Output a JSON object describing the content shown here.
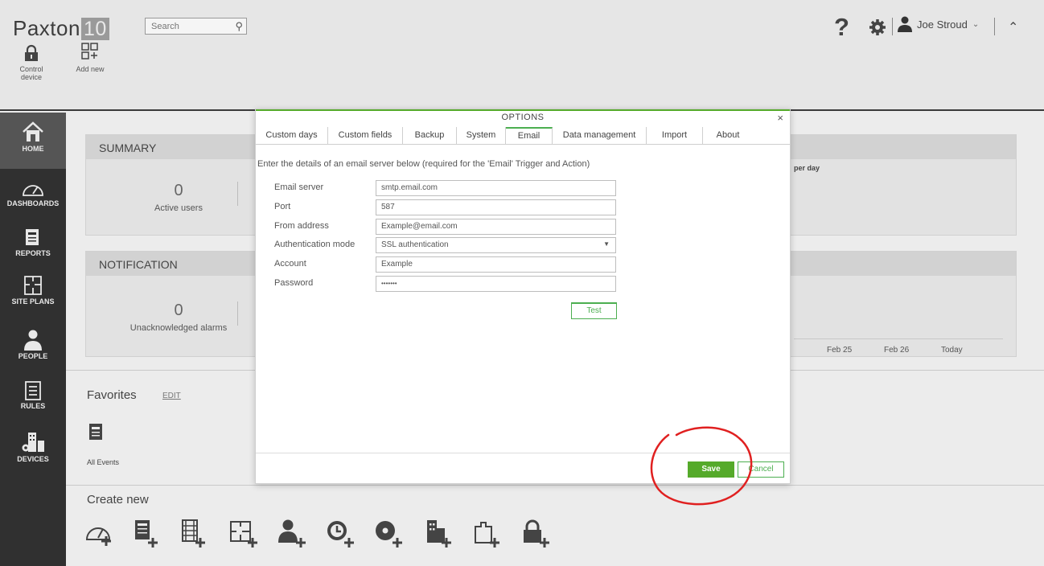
{
  "app": {
    "name": "Paxton",
    "version": "10"
  },
  "search": {
    "placeholder": "Search"
  },
  "toolbar": {
    "control_device": "Control device",
    "add_new": "Add new"
  },
  "user": {
    "name": "Joe Stroud"
  },
  "sidebar": {
    "items": [
      {
        "label": "HOME",
        "icon": "home-icon",
        "active": true
      },
      {
        "label": "DASHBOARDS",
        "icon": "gauge-icon"
      },
      {
        "label": "REPORTS",
        "icon": "report-icon"
      },
      {
        "label": "SITE PLANS",
        "icon": "site-plan-icon"
      },
      {
        "label": "PEOPLE",
        "icon": "person-icon"
      },
      {
        "label": "RULES",
        "icon": "rules-icon"
      },
      {
        "label": "DEVICES",
        "icon": "devices-icon"
      }
    ]
  },
  "summary": {
    "title": "SUMMARY",
    "value": "0",
    "label": "Active users"
  },
  "notification": {
    "title": "NOTIFICATION",
    "value": "0",
    "label": "Unacknowledged alarms"
  },
  "chart": {
    "title": "per day",
    "x_labels": [
      "Feb 25",
      "Feb 26",
      "Today"
    ]
  },
  "favorites": {
    "title": "Favorites",
    "edit": "EDIT",
    "items": [
      {
        "label": "All Events",
        "icon": "report-icon"
      }
    ]
  },
  "create_new": {
    "title": "Create new",
    "items": [
      "dashboard-add-icon",
      "report-add-icon",
      "video-report-add-icon",
      "site-plan-add-icon",
      "person-add-icon",
      "time-profile-add-icon",
      "software-add-icon",
      "building-add-icon",
      "system-rule-add-icon",
      "device-add-icon"
    ]
  },
  "dialog": {
    "title": "OPTIONS",
    "close": "×",
    "tabs": [
      "Custom days",
      "Custom fields",
      "Backup",
      "System",
      "Email",
      "Data management",
      "Import",
      "About"
    ],
    "active_tab": "Email",
    "intro": "Enter the details of an email server below (required for the 'Email' Trigger and Action)",
    "fields": {
      "email_server": {
        "label": "Email server",
        "value": "smtp.email.com"
      },
      "port": {
        "label": "Port",
        "value": "587"
      },
      "from_address": {
        "label": "From address",
        "value": "Example@email.com"
      },
      "auth_mode": {
        "label": "Authentication mode",
        "value": "SSL authentication"
      },
      "account": {
        "label": "Account",
        "value": "Example"
      },
      "password": {
        "label": "Password",
        "value": "•••••••"
      }
    },
    "test": "Test",
    "save": "Save",
    "cancel": "Cancel"
  },
  "colors": {
    "accent_green": "#55aa2a",
    "sidebar_bg": "#303030",
    "highlight_ring": "#e02020"
  }
}
